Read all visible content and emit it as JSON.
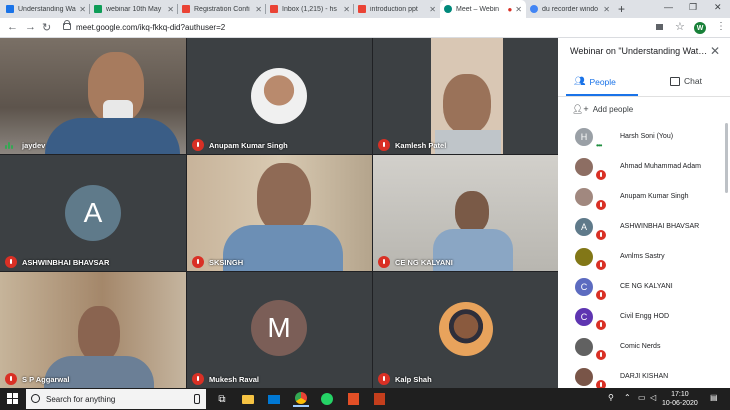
{
  "browser": {
    "tabs": [
      {
        "label": "Understanding Wa",
        "favicon_color": "#1a73e8"
      },
      {
        "label": "webinar 10th May",
        "favicon_color": "#0f9d58"
      },
      {
        "label": "Registration Confi",
        "favicon_color": "#ea4335"
      },
      {
        "label": "Inbox (1,215) - hs",
        "favicon_color": "#ea4335"
      },
      {
        "label": "introduction ppt",
        "favicon_color": "#ea4335"
      },
      {
        "label": "Meet – Webin",
        "favicon_color": "#00897b"
      },
      {
        "label": "du recorder windo",
        "favicon_color": "#4285f4"
      }
    ],
    "new_tab": "+",
    "url": "meet.google.com/ikq-fkkq-did?authuser=2",
    "profile_initial": "W"
  },
  "meet": {
    "participants_tiles": [
      {
        "name": "jaydev",
        "muted": false,
        "kind": "video"
      },
      {
        "name": "Anupam Kumar Singh",
        "muted": true,
        "kind": "photo"
      },
      {
        "name": "Kamlesh Patel",
        "muted": true,
        "kind": "video"
      },
      {
        "name": "ASHWINBHAI BHAVSAR",
        "muted": true,
        "kind": "letter",
        "letter": "A",
        "color": "#5f7a8a"
      },
      {
        "name": "SKSINGH",
        "muted": true,
        "kind": "video"
      },
      {
        "name": "CE NG KALYANI",
        "muted": true,
        "kind": "video"
      },
      {
        "name": "S P Aggarwal",
        "muted": true,
        "kind": "video"
      },
      {
        "name": "Mukesh Raval",
        "muted": true,
        "kind": "letter",
        "letter": "M",
        "color": "#7b5e57"
      },
      {
        "name": "Kalp Shah",
        "muted": true,
        "kind": "photo"
      }
    ]
  },
  "panel": {
    "title": "Webinar on \"Understanding Wat…",
    "tab_people": "People",
    "tab_chat": "Chat",
    "add_people": "Add people",
    "people": [
      {
        "name": "Harsh Soni (You)",
        "initial": "H",
        "color": "#9aa0a6",
        "muted": false,
        "kind": "letter"
      },
      {
        "name": "Ahmad Muhammad Adam",
        "initial": "",
        "color": "#8d6e63",
        "muted": true,
        "kind": "photo"
      },
      {
        "name": "Anupam Kumar Singh",
        "initial": "",
        "color": "#a1887f",
        "muted": true,
        "kind": "photo"
      },
      {
        "name": "ASHWINBHAI BHAVSAR",
        "initial": "A",
        "color": "#5f7a8a",
        "muted": true,
        "kind": "letter"
      },
      {
        "name": "Avnlms Sastry",
        "initial": "",
        "color": "#827717",
        "muted": true,
        "kind": "photo"
      },
      {
        "name": "CE NG KALYANI",
        "initial": "C",
        "color": "#5c6bc0",
        "muted": true,
        "kind": "letter"
      },
      {
        "name": "Civil Engg HOD",
        "initial": "C",
        "color": "#5e35b1",
        "muted": true,
        "kind": "letter"
      },
      {
        "name": "Comic Nerds",
        "initial": "",
        "color": "#616161",
        "muted": true,
        "kind": "photo"
      },
      {
        "name": "DARJI KISHAN",
        "initial": "",
        "color": "#795548",
        "muted": true,
        "kind": "photo"
      }
    ]
  },
  "taskbar": {
    "search_placeholder": "Search for anything",
    "time": "17:10",
    "date": "10-06-2020"
  }
}
